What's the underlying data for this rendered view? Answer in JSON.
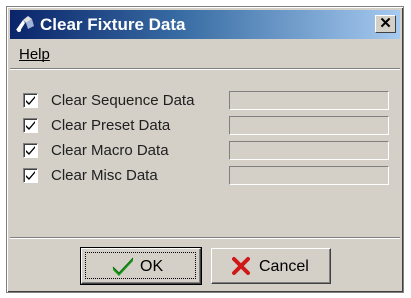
{
  "window": {
    "title": "Clear Fixture Data",
    "close_glyph": "✕"
  },
  "menu": {
    "items": [
      {
        "label": "Help"
      }
    ]
  },
  "options": [
    {
      "label": "Clear Sequence Data",
      "checked": true,
      "progress": 0
    },
    {
      "label": "Clear Preset Data",
      "checked": true,
      "progress": 0
    },
    {
      "label": "Clear Macro Data",
      "checked": true,
      "progress": 0
    },
    {
      "label": "Clear Misc Data",
      "checked": true,
      "progress": 0
    }
  ],
  "buttons": {
    "ok_label": "OK",
    "cancel_label": "Cancel"
  },
  "icons": {
    "app": "fixture-icon",
    "ok": "checkmark-icon",
    "cancel": "cross-icon",
    "close": "close-icon"
  },
  "colors": {
    "title_gradient_start": "#0a246a",
    "title_gradient_end": "#a6caf0",
    "face": "#d4d0c8",
    "ok_check": "#1a9a1a",
    "cancel_cross": "#d01818"
  }
}
